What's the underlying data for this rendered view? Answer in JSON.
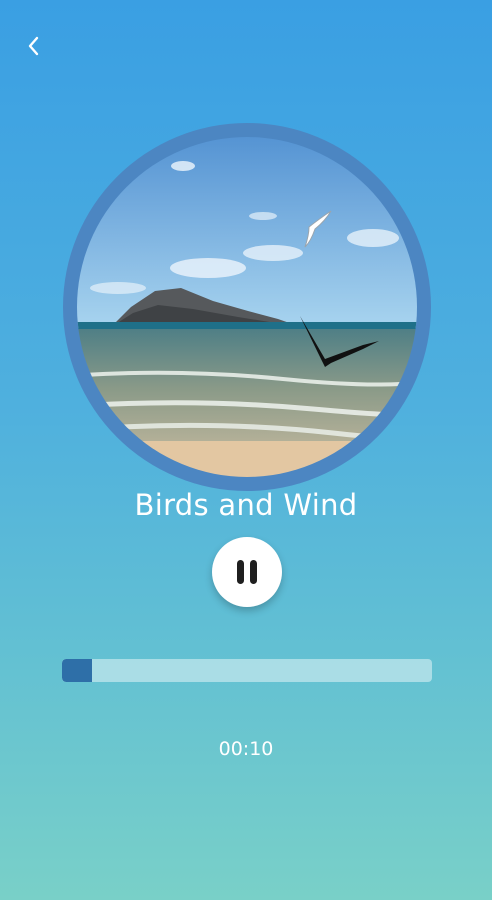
{
  "player": {
    "back_icon": "chevron-left-icon",
    "artwork_icon": "beach-birds-artwork",
    "track_title": "Birds and Wind",
    "play_state_icon": "pause-icon",
    "progress_fraction": 0.08,
    "elapsed_time": "00:10"
  },
  "colors": {
    "accent": "#2e6fa8",
    "artwork_ring": "#4c86c2",
    "background_top": "#3a9fe3",
    "background_bottom": "#79d0c8"
  }
}
